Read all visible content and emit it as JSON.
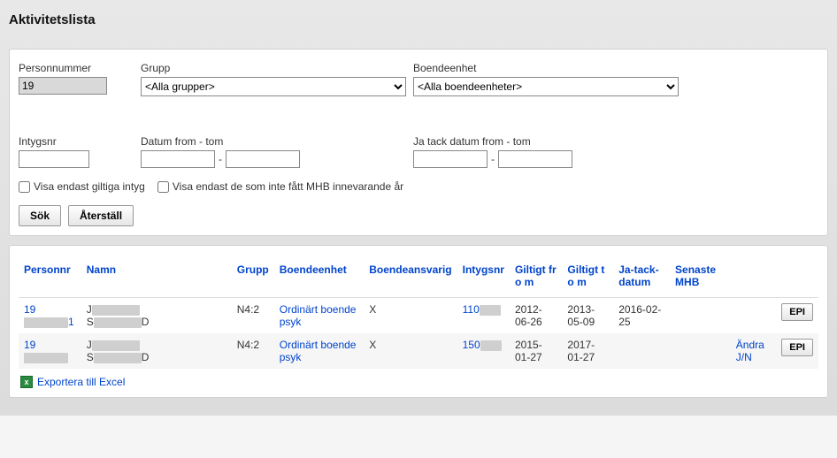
{
  "title": "Aktivitetslista",
  "filters": {
    "personnummer_label": "Personnummer",
    "personnummer_value": "19",
    "grupp_label": "Grupp",
    "grupp_selected": "<Alla grupper>",
    "boendeenhet_label": "Boendeenhet",
    "boendeenhet_selected": "<Alla boendeenheter>",
    "intygsnr_label": "Intygsnr",
    "intygsnr_value": "",
    "datum_label": "Datum from - tom",
    "datum_from": "",
    "datum_tom": "",
    "jatack_label": "Ja tack datum from - tom",
    "jatack_from": "",
    "jatack_tom": "",
    "chk_giltiga": "Visa endast giltiga intyg",
    "chk_giltiga_checked": false,
    "chk_mhb": "Visa endast de som inte fått MHB innevarande år",
    "chk_mhb_checked": false,
    "sok": "Sök",
    "aterstall": "Återställ"
  },
  "headers": {
    "personnr": "Personnr",
    "namn": "Namn",
    "grupp": "Grupp",
    "boendeenhet": "Boendeenhet",
    "boendeansvarig": "Boendeansvarig",
    "intygsnr": "Intygsnr",
    "giltig_from": "Giltigt fr o m",
    "giltig_tom": "Giltigt t o m",
    "jatack": "Ja-tack-datum",
    "senaste_mhb": "Senaste MHB"
  },
  "rows": [
    {
      "personnr_prefix": "19",
      "personnr_suffix": "1",
      "namn_prefix": "J",
      "namn_line2_prefix": "S",
      "namn_line2_suffix": "D",
      "grupp": "N4:2",
      "boendeenhet": "Ordinärt boende psyk",
      "boendeansvarig": "X",
      "intygsnr_prefix": "110",
      "giltig_from": "2012-06-26",
      "giltig_tom": "2013-05-09",
      "jatack": "2016-02-25",
      "senaste_mhb": "",
      "epi": "EPI",
      "andra": ""
    },
    {
      "personnr_prefix": "19",
      "personnr_suffix": "",
      "namn_prefix": "J",
      "namn_line2_prefix": "S",
      "namn_line2_suffix": "D",
      "grupp": "N4:2",
      "boendeenhet": "Ordinärt boende psyk",
      "boendeansvarig": "X",
      "intygsnr_prefix": "150",
      "giltig_from": "2015-01-27",
      "giltig_tom": "2017-01-27",
      "jatack": "",
      "senaste_mhb": "",
      "epi": "EPI",
      "andra": "Ändra J/N"
    }
  ],
  "export_label": "Exportera till Excel"
}
